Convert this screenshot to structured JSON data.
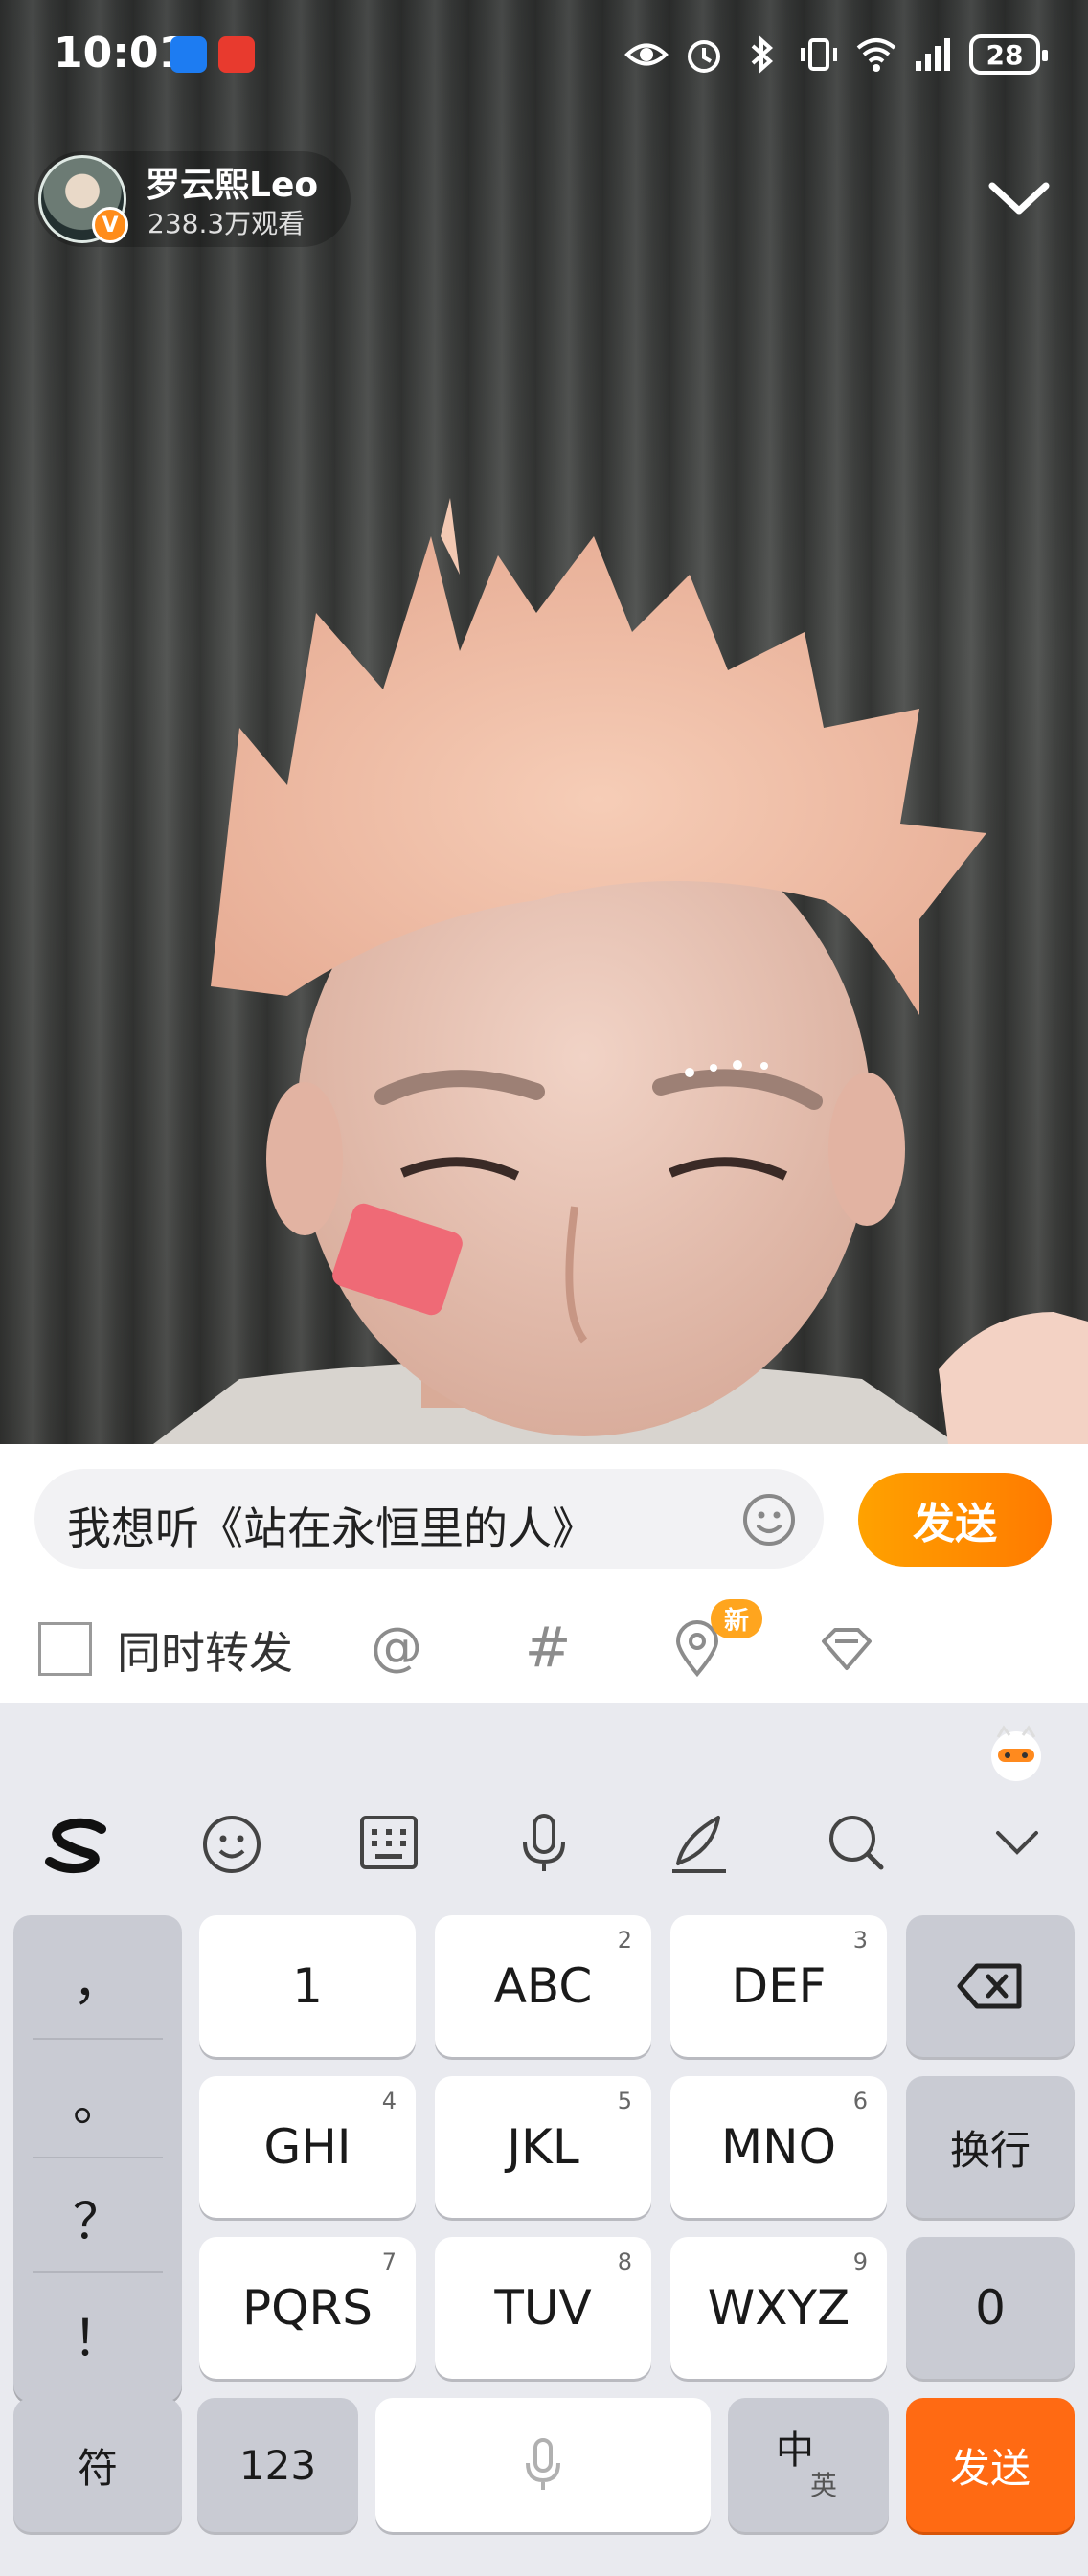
{
  "status_bar": {
    "time": "10:01",
    "battery": "28"
  },
  "streamer": {
    "name": "罗云熙Leo",
    "viewers": "238.3万观看",
    "verified_badge": "V"
  },
  "comment": {
    "input_value": "我想听《站在永恒里的人》",
    "send_label": "发送",
    "repost_label": "同时转发",
    "new_badge": "新",
    "at_symbol": "@",
    "hash_symbol": "#"
  },
  "keyboard": {
    "punctuation": [
      "，",
      "。",
      "？",
      "！"
    ],
    "rows": [
      [
        {
          "label": "1",
          "num": ""
        },
        {
          "label": "ABC",
          "num": "2"
        },
        {
          "label": "DEF",
          "num": "3"
        }
      ],
      [
        {
          "label": "GHI",
          "num": "4"
        },
        {
          "label": "JKL",
          "num": "5"
        },
        {
          "label": "MNO",
          "num": "6"
        }
      ],
      [
        {
          "label": "PQRS",
          "num": "7"
        },
        {
          "label": "TUV",
          "num": "8"
        },
        {
          "label": "WXYZ",
          "num": "9"
        }
      ]
    ],
    "newline_label": "换行",
    "zero_label": "0",
    "symbols_label": "符",
    "numbers_label": "123",
    "lang_main": "中",
    "lang_alt": "英",
    "send_label": "发送"
  },
  "colors": {
    "accent_orange": "#ff7a00",
    "send_key_orange": "#ff6a13",
    "badge_orange": "#ffa51e"
  },
  "icons": {
    "status": [
      "eye-icon",
      "alarm-icon",
      "bluetooth-icon",
      "vibrate-icon",
      "wifi-icon",
      "signal-icon"
    ],
    "toolbar": [
      "sogou-logo-icon",
      "emoji-icon",
      "keyboard-icon",
      "microphone-icon",
      "handwriting-icon",
      "search-icon",
      "chevron-down-icon"
    ]
  }
}
